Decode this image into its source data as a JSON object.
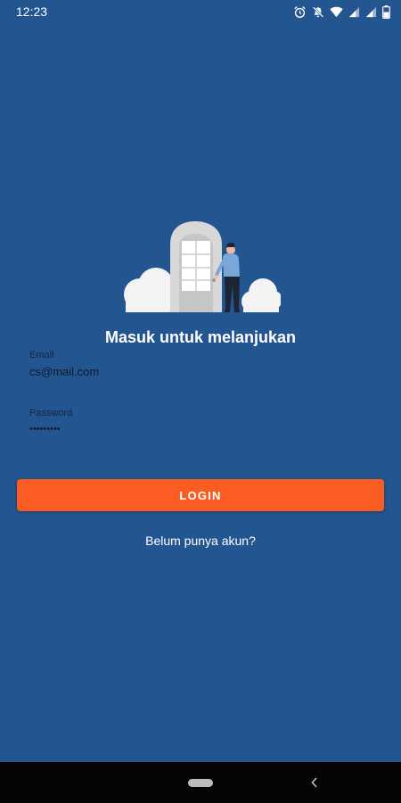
{
  "status_bar": {
    "time": "12:23",
    "icons": [
      "alarm-icon",
      "notifications-off-icon",
      "wifi-icon",
      "signal-icon",
      "signal-icon",
      "battery-icon"
    ]
  },
  "illustration": {
    "name": "person-opening-door-illustration",
    "colors": {
      "door": "#d9d9d9",
      "window": "#ffffff",
      "shirt": "#7aa6d8",
      "pants": "#1d2433",
      "skin": "#f2b8a0",
      "clouds": "#f2f2f2"
    }
  },
  "login": {
    "heading": "Masuk untuk melanjukan",
    "email_label": "Email",
    "email_value": "cs@mail.com",
    "password_label": "Password",
    "password_dots": "•••••••••",
    "button_label": "LOGIN",
    "register_link": "Belum punya akun?"
  },
  "colors": {
    "background": "#235591",
    "button": "#fb5c21",
    "navigation_bar": "#050505"
  },
  "nav_bar": {
    "icons": [
      "home-pill-icon",
      "back-chevron-icon"
    ]
  }
}
